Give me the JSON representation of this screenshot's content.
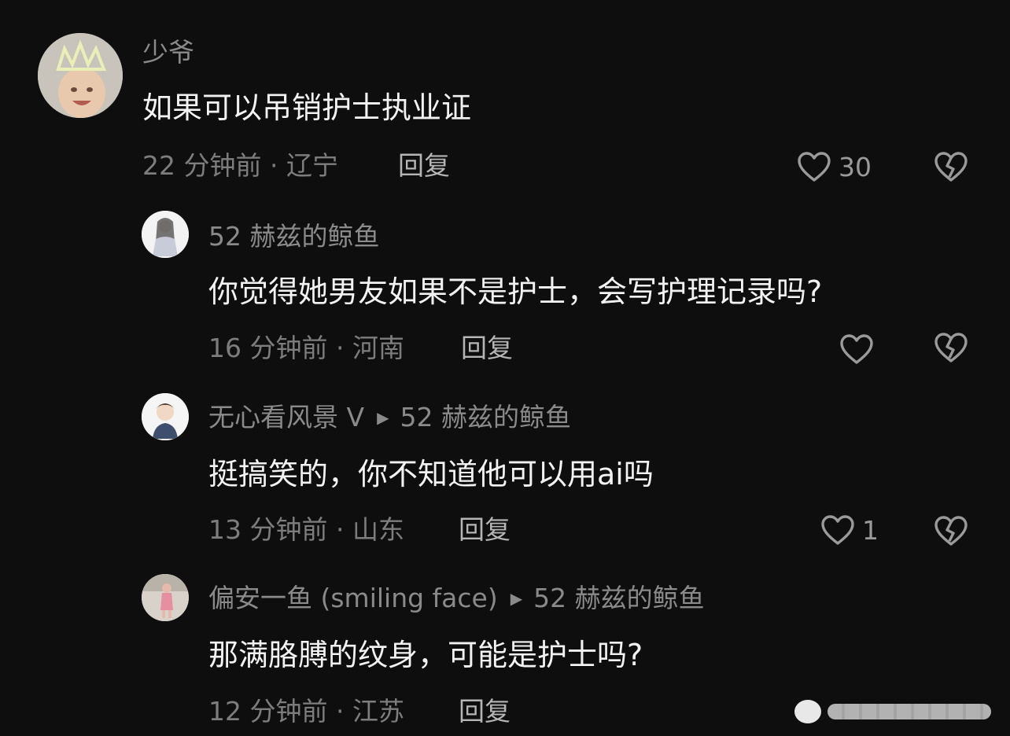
{
  "comments": [
    {
      "author": "少爷",
      "reply_to": "",
      "text": "如果可以吊销护士执业证",
      "time_location": "22 分钟前 · 辽宁",
      "reply_label": "回复",
      "likes": "30",
      "avatar": "crowned-baby-avatar"
    },
    {
      "author": "52 赫兹的鲸鱼",
      "reply_to": "",
      "text": "你觉得她男友如果不是护士，会写护理记录吗?",
      "time_location": "16 分钟前 · 河南",
      "reply_label": "回复",
      "likes": "",
      "avatar": "drawn-figure-avatar"
    },
    {
      "author": "无心看风景 V",
      "reply_to": "52 赫兹的鲸鱼",
      "text": "挺搞笑的，你不知道他可以用ai吗",
      "time_location": "13 分钟前 · 山东",
      "reply_label": "回复",
      "likes": "1",
      "avatar": "cartoon-boy-avatar"
    },
    {
      "author": "偏安一鱼 (smiling face)",
      "reply_to": "52 赫兹的鲸鱼",
      "text": "那满胳膊的纹身，可能是护士吗?",
      "time_location": "12 分钟前 · 江苏",
      "reply_label": "回复",
      "likes": "",
      "avatar": "pink-figure-avatar"
    }
  ],
  "icons": {
    "like": "heart-outline-icon",
    "dislike": "broken-heart-icon",
    "reply_arrow": "triangle-right-icon"
  },
  "colors": {
    "background": "#0e0e0e",
    "author": "#8a8a8a",
    "text": "#f2f2f2",
    "meta": "#7d7d7d"
  }
}
